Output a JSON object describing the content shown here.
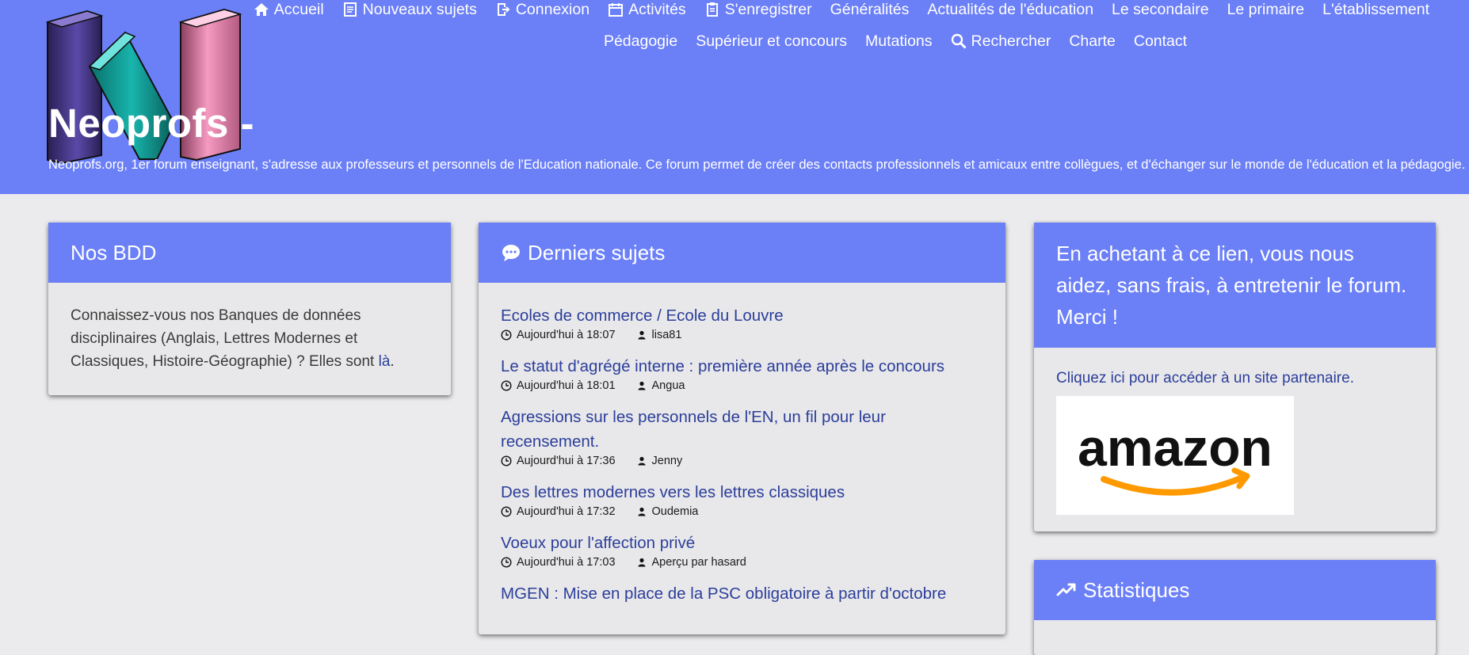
{
  "header": {
    "nav_row1": [
      {
        "label": "Accueil",
        "icon": "home-icon"
      },
      {
        "label": "Nouveaux sujets",
        "icon": "new-topics-icon"
      },
      {
        "label": "Connexion",
        "icon": "login-icon"
      },
      {
        "label": "Activités",
        "icon": "calendar-icon"
      },
      {
        "label": "S'enregistrer",
        "icon": "register-icon"
      },
      {
        "label": "Généralités"
      },
      {
        "label": "Actualités de l'éducation"
      },
      {
        "label": "Le secondaire"
      },
      {
        "label": "Le primaire"
      },
      {
        "label": "L'établissement"
      }
    ],
    "nav_row2": [
      {
        "label": "Pédagogie"
      },
      {
        "label": "Supérieur et concours"
      },
      {
        "label": "Mutations"
      },
      {
        "label": "Rechercher",
        "icon": "search-icon"
      },
      {
        "label": "Charte"
      },
      {
        "label": "Contact"
      }
    ],
    "site_title": "Neoprofs -",
    "site_description": "Neoprofs.org, 1er forum enseignant, s'adresse aux professeurs et personnels de l'Education nationale. Ce forum permet de créer des contacts professionnels et amicaux entre collègues, et d'échanger sur le monde de l'éducation et la pédagogie."
  },
  "bdd_panel": {
    "title": "Nos BDD",
    "text": "Connaissez-vous nos Banques de données disciplinaires (Anglais, Lettres Modernes et Classiques, Histoire-Géographie) ? Elles sont ",
    "link": "là",
    "text_end": "."
  },
  "topics_panel": {
    "title": "Derniers sujets",
    "topics": [
      {
        "title": "Ecoles de commerce / Ecole du Louvre",
        "time": "Aujourd'hui à 18:07",
        "author": "lisa81"
      },
      {
        "title": "Le statut d'agrégé interne : première année après le concours",
        "time": "Aujourd'hui à 18:01",
        "author": "Angua"
      },
      {
        "title": "Agressions sur les personnels de l'EN, un fil pour leur recensement.",
        "time": "Aujourd'hui à 17:36",
        "author": "Jenny"
      },
      {
        "title": "Des lettres modernes vers les lettres classiques",
        "time": "Aujourd'hui à 17:32",
        "author": "Oudemia"
      },
      {
        "title": "Voeux pour l'affection privé",
        "time": "Aujourd'hui à 17:03",
        "author": "Aperçu par hasard"
      },
      {
        "title": "MGEN : Mise en place de la PSC obligatoire à partir d'octobre",
        "time": "",
        "author": ""
      }
    ]
  },
  "amazon_panel": {
    "title": "En achetant à ce lien, vous nous aidez, sans frais, à entretenir le forum. Merci !",
    "link_text": "Cliquez ici pour accéder à un site partenaire.",
    "logo_text": "amazon"
  },
  "stats_panel": {
    "title": "Statistiques"
  },
  "colors": {
    "brand_blue": "#6b7ff7",
    "link_blue": "#2c3e9a",
    "background": "#ebebed",
    "panel_bg": "#e8e8ea",
    "amazon_orange": "#f90"
  }
}
